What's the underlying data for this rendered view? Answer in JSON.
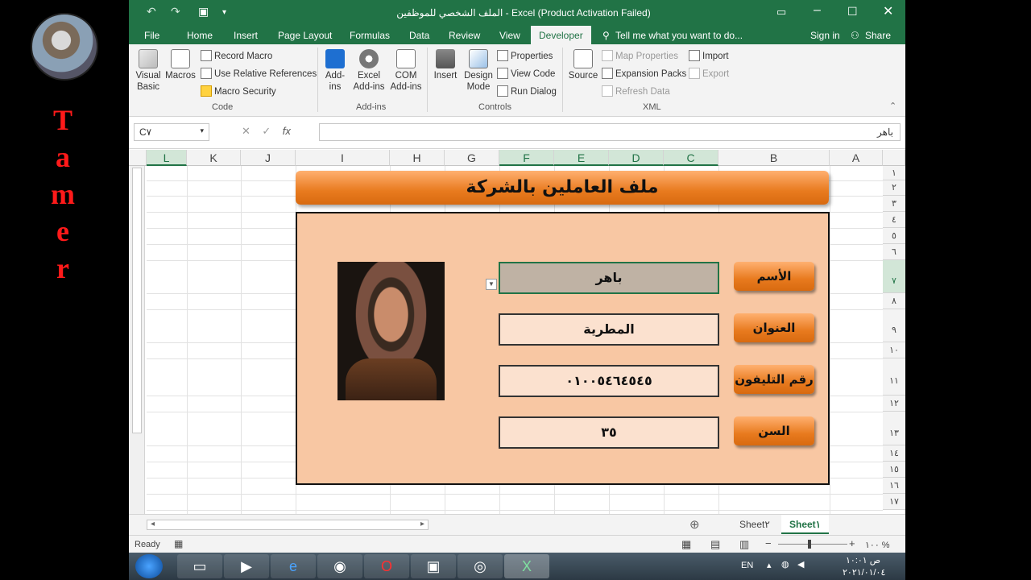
{
  "channel": {
    "name_letters": [
      "T",
      "a",
      "m",
      "e",
      "r"
    ]
  },
  "window": {
    "title": "الملف الشخصي للموظفين - Excel (Product Activation Failed)",
    "controls": {
      "restore_icon": "ribbon-display-icon",
      "min": "–",
      "max": "☐",
      "close": "✕"
    }
  },
  "tabs": {
    "items": [
      "File",
      "Home",
      "Insert",
      "Page Layout",
      "Formulas",
      "Data",
      "Review",
      "View",
      "Developer"
    ],
    "active": "Developer",
    "tell_me": "Tell me what you want to do...",
    "sign_in": "Sign in",
    "share": "Share"
  },
  "ribbon": {
    "code": {
      "visual_basic": "Visual Basic",
      "macros": "Macros",
      "record_macro": "Record Macro",
      "use_relative": "Use Relative References",
      "macro_security": "Macro Security",
      "label": "Code"
    },
    "addins": {
      "addins": "Add-ins",
      "excel_addins": "Excel Add-ins",
      "com_addins": "COM Add-ins",
      "label": "Add-ins"
    },
    "controls": {
      "insert": "Insert",
      "design_mode": "Design Mode",
      "properties": "Properties",
      "view_code": "View Code",
      "run_dialog": "Run Dialog",
      "label": "Controls"
    },
    "xml": {
      "source": "Source",
      "map_properties": "Map Properties",
      "expansion_packs": "Expansion Packs",
      "refresh_data": "Refresh Data",
      "import": "Import",
      "export": "Export",
      "label": "XML"
    }
  },
  "formula_bar": {
    "name_box": "C٧",
    "formula": "باهر"
  },
  "columns": [
    "L",
    "K",
    "J",
    "I",
    "H",
    "G",
    "F",
    "E",
    "D",
    "C",
    "B",
    "A"
  ],
  "rows": [
    "١",
    "٢",
    "٣",
    "٤",
    "٥",
    "٦",
    "٧",
    "٨",
    "٩",
    "١٠",
    "١١",
    "١٢",
    "١٣",
    "١٤",
    "١٥",
    "١٦",
    "١٧"
  ],
  "sheet": {
    "banner": "ملف العاملين بالشركة",
    "fields": [
      {
        "label": "الأسم",
        "value": "باهر"
      },
      {
        "label": "العنوان",
        "value": "المطرية"
      },
      {
        "label": "رقم التليفون",
        "value": "٠١٠٠٥٤٦٤٥٤٥"
      },
      {
        "label": "السن",
        "value": "٣٥"
      }
    ]
  },
  "sheet_tabs": {
    "sheet2": "Sheet٢",
    "sheet1": "Sheet١",
    "active": "Sheet١"
  },
  "status": {
    "ready": "Ready",
    "zoom": "١٠٠ %"
  },
  "taskbar": {
    "language": "EN",
    "time": "ص ١٠:٠١",
    "date": "٢٠٢١/٠١/٠٤"
  }
}
